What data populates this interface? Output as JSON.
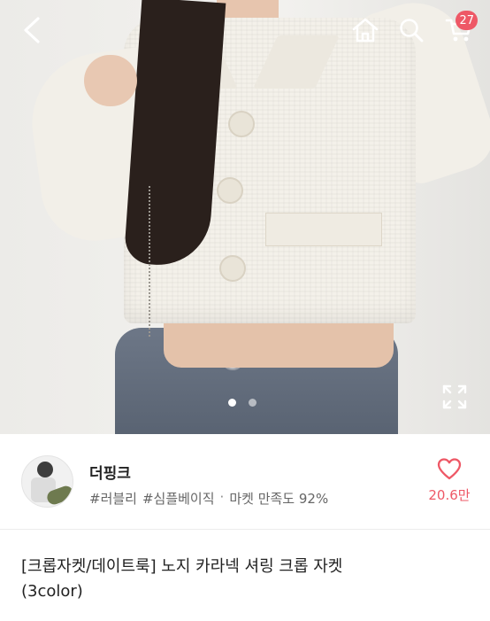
{
  "header": {
    "back_icon": "chevron-left-icon",
    "home_icon": "home-icon",
    "search_icon": "search-icon",
    "cart_icon": "cart-icon",
    "cart_count": "27",
    "badge_color": "#ee5866"
  },
  "gallery": {
    "total_images": 2,
    "current_index": 1,
    "expand_icon": "expand-icon"
  },
  "seller": {
    "name": "더핑크",
    "tag1": "#러블리",
    "tag2": "#심플베이직",
    "separator": "·",
    "satisfaction": "마켓 만족도 92%",
    "like_icon": "heart-icon",
    "like_count": "20.6만",
    "accent_color": "#ee5866"
  },
  "product": {
    "title_line1": "[크롭자켓/데이트룩] 노지 카라넥 셔링 크롭 자켓",
    "title_line2": "(3color)"
  }
}
